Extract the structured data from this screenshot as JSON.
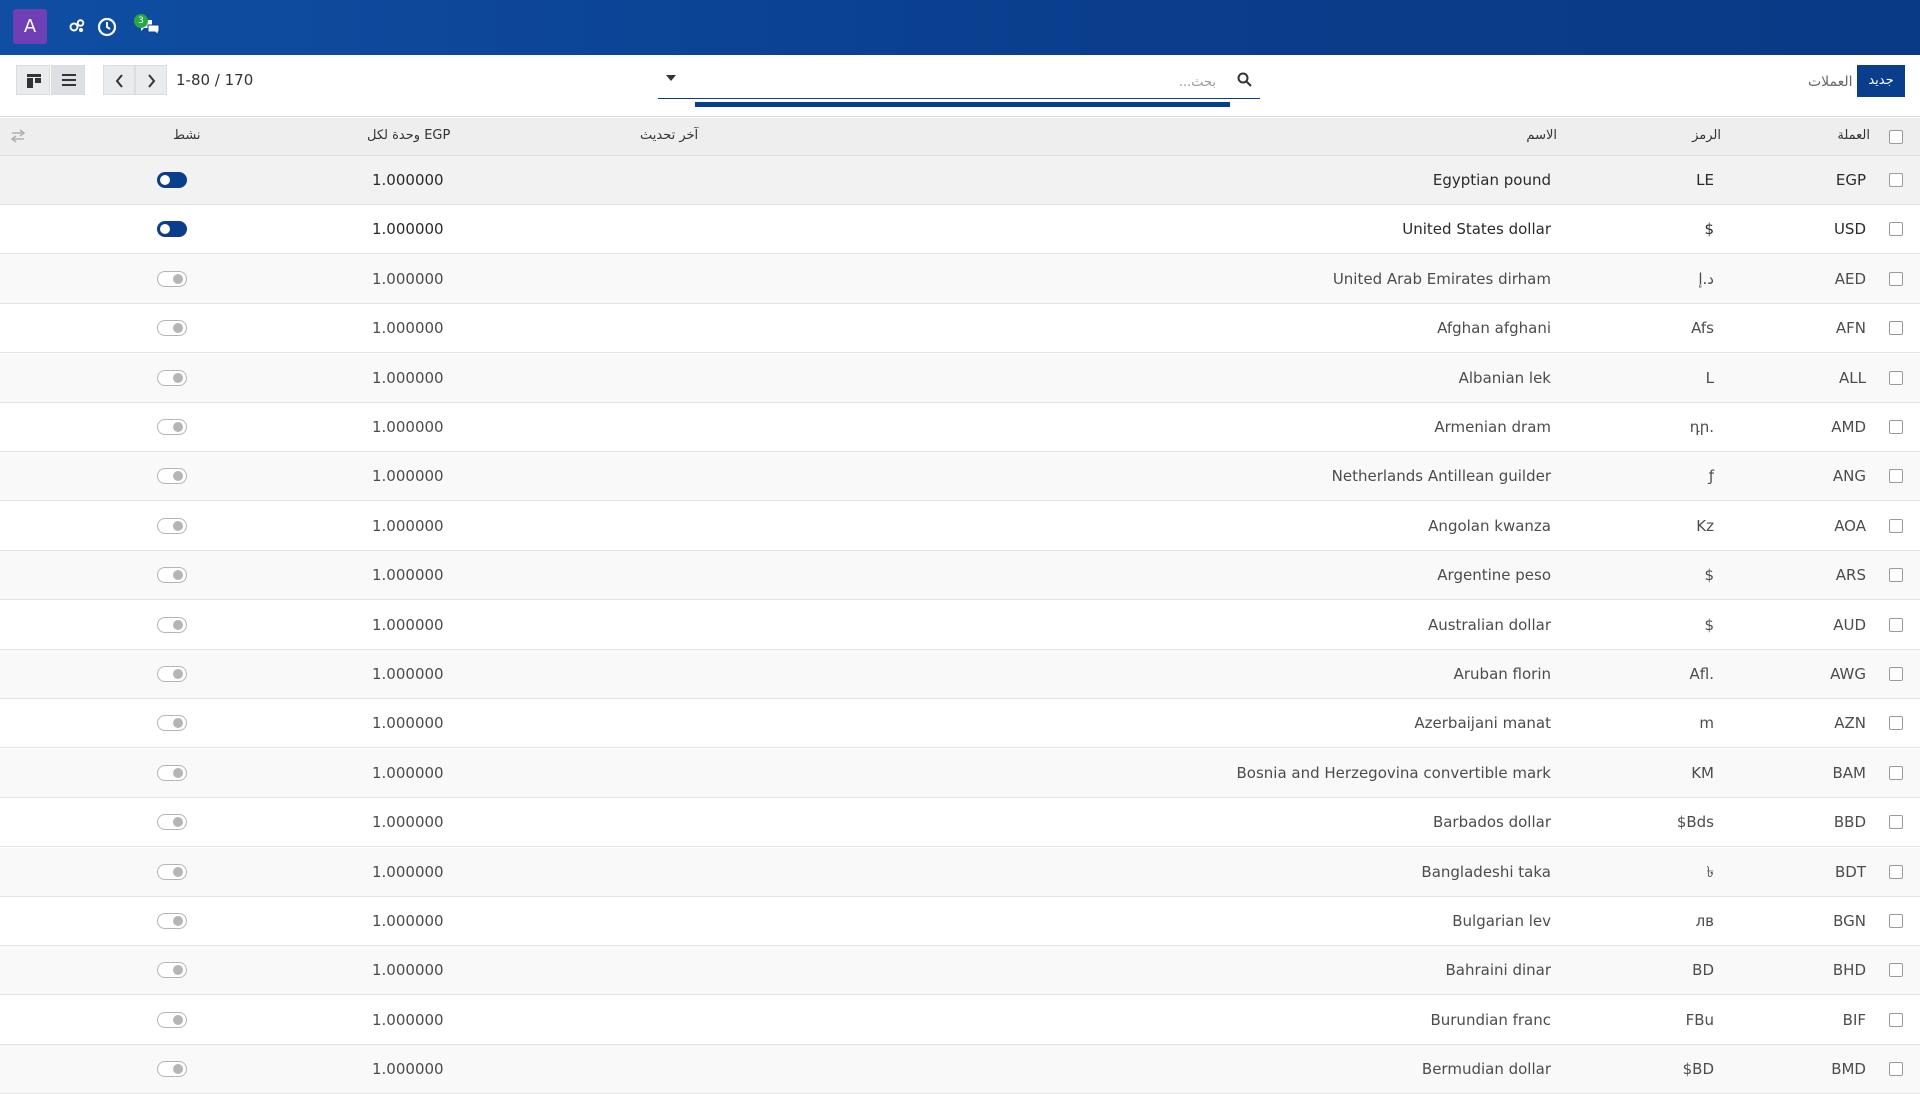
{
  "navbar": {
    "avatar_letter": "A",
    "messages_badge": "3"
  },
  "control_panel": {
    "pager_value": "1-80 / 170",
    "search_placeholder": "بحث...",
    "breadcrumb": "العملات",
    "new_button_label": "جديد"
  },
  "table": {
    "headers": {
      "currency": "العملة",
      "symbol": "الرمز",
      "name": "الاسم",
      "last_update": "آخر تحديث",
      "rate": "وحدة لكل EGP",
      "active": "نشط"
    },
    "rows": [
      {
        "code": "EGP",
        "symbol": "LE",
        "name": "Egyptian pound",
        "rate": "1.000000",
        "active": true
      },
      {
        "code": "USD",
        "symbol": "$",
        "name": "United States dollar",
        "rate": "1.000000",
        "active": true
      },
      {
        "code": "AED",
        "symbol": "د.إ",
        "name": "United Arab Emirates dirham",
        "rate": "1.000000",
        "active": false
      },
      {
        "code": "AFN",
        "symbol": "Afs",
        "name": "Afghan afghani",
        "rate": "1.000000",
        "active": false
      },
      {
        "code": "ALL",
        "symbol": "L",
        "name": "Albanian lek",
        "rate": "1.000000",
        "active": false
      },
      {
        "code": "AMD",
        "symbol": "դր.",
        "name": "Armenian dram",
        "rate": "1.000000",
        "active": false
      },
      {
        "code": "ANG",
        "symbol": "ƒ",
        "name": "Netherlands Antillean guilder",
        "rate": "1.000000",
        "active": false
      },
      {
        "code": "AOA",
        "symbol": "Kz",
        "name": "Angolan kwanza",
        "rate": "1.000000",
        "active": false
      },
      {
        "code": "ARS",
        "symbol": "$",
        "name": "Argentine peso",
        "rate": "1.000000",
        "active": false
      },
      {
        "code": "AUD",
        "symbol": "$",
        "name": "Australian dollar",
        "rate": "1.000000",
        "active": false
      },
      {
        "code": "AWG",
        "symbol": "Afl.",
        "name": "Aruban florin",
        "rate": "1.000000",
        "active": false
      },
      {
        "code": "AZN",
        "symbol": "m",
        "name": "Azerbaijani manat",
        "rate": "1.000000",
        "active": false
      },
      {
        "code": "BAM",
        "symbol": "KM",
        "name": "Bosnia and Herzegovina convertible mark",
        "rate": "1.000000",
        "active": false
      },
      {
        "code": "BBD",
        "symbol": "$Bds",
        "name": "Barbados dollar",
        "rate": "1.000000",
        "active": false
      },
      {
        "code": "BDT",
        "symbol": "৳",
        "name": "Bangladeshi taka",
        "rate": "1.000000",
        "active": false
      },
      {
        "code": "BGN",
        "symbol": "лв",
        "name": "Bulgarian lev",
        "rate": "1.000000",
        "active": false
      },
      {
        "code": "BHD",
        "symbol": "BD",
        "name": "Bahraini dinar",
        "rate": "1.000000",
        "active": false
      },
      {
        "code": "BIF",
        "symbol": "FBu",
        "name": "Burundian franc",
        "rate": "1.000000",
        "active": false
      },
      {
        "code": "BMD",
        "symbol": "$BD",
        "name": "Bermudian dollar",
        "rate": "1.000000",
        "active": false
      }
    ]
  },
  "icons": {
    "debug": "bugs-icon",
    "activity": "clock-icon",
    "messages": "chat-icon",
    "search": "search-icon",
    "kanban": "kanban-view-icon",
    "list": "list-view-icon",
    "prev": "chevron-left-icon",
    "next": "chevron-right-icon",
    "settings": "optional-columns-icon"
  },
  "colors": {
    "navbar": "#0a3d8c",
    "avatar": "#6f3fb5",
    "primary": "#0a3d8c",
    "badge": "#28a745"
  }
}
